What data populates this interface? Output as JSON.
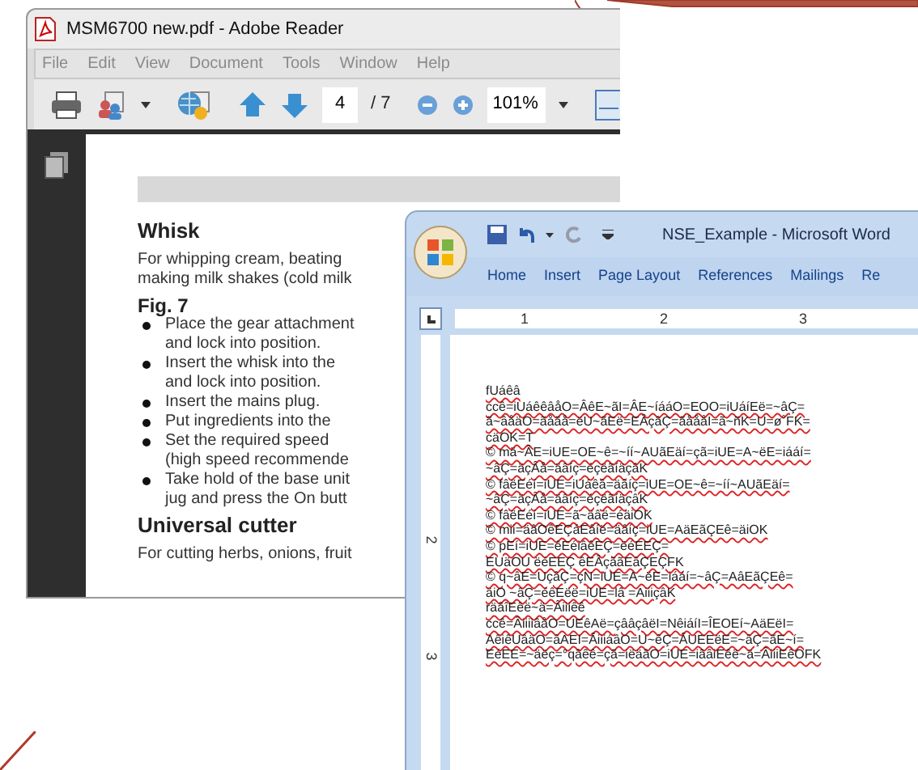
{
  "reader": {
    "title": "MSM6700 new.pdf - Adobe Reader",
    "menu": [
      "File",
      "Edit",
      "View",
      "Document",
      "Tools",
      "Window",
      "Help"
    ],
    "page_number": "4",
    "page_total": "/ 7",
    "zoom": "101%",
    "content": [
      {
        "kind": "heading",
        "text": "Whisk"
      },
      {
        "kind": "para",
        "text": "For whipping cream, beating"
      },
      {
        "kind": "para",
        "text": "making milk shakes (cold milk"
      },
      {
        "kind": "subheading",
        "text": "Fig. 7"
      },
      {
        "kind": "bullet",
        "lines": [
          "Place the gear attachment",
          "and lock into position."
        ]
      },
      {
        "kind": "bullet",
        "lines": [
          "Insert the whisk into the",
          "and lock into position."
        ]
      },
      {
        "kind": "bullet",
        "lines": [
          "Insert the mains plug."
        ]
      },
      {
        "kind": "bullet",
        "lines": [
          "Put ingredients into the"
        ]
      },
      {
        "kind": "bullet",
        "lines": [
          "Set the required speed",
          "(high speed recommende"
        ]
      },
      {
        "kind": "bullet",
        "lines": [
          "Take hold of the base unit",
          "jug and press the On butt"
        ]
      },
      {
        "kind": "heading",
        "text": "Universal cutter"
      },
      {
        "kind": "para",
        "text": "For cutting herbs, onions, fruit"
      }
    ]
  },
  "word": {
    "title": "NSE_Example - Microsoft Word",
    "tabs": [
      "Home",
      "Insert",
      "Page Layout",
      "References",
      "Mailings",
      "Re"
    ],
    "ruler": [
      "1",
      "2",
      "3"
    ],
    "vruler": [
      "2",
      "3"
    ],
    "lines": [
      "fUáêâ",
      "ccê=iUáêêâåO=ÂêE~ãI=ÂE~íááO=EOO=iUáíEë=~âÇ=",
      "ã~âåäO=ãåãå=ëU~ãEë=EÂçâÇ=ãåååI=ã~ñK=U=ø˚FK=",
      "cäOK=T",
      "© mä~ÂE=iUE=OE~ê=~íí~AUãEäí=çã=iUE=A~ëE=iááí=",
      "~âÇ=äçÂå=äâíç=éçëãíäçâK",
      "© fâëEéí=iUE=iUáêâ=äâíç=iUE=OE~ê=~íí~AUãEäí=",
      "~âÇ=äçÂå=äâíç=éçëãíäçâK",
      "© fâëEéí=iUE=ã~äâë=éäiOK",
      "© mii=äâOêEÇáEâíë=äâíç=iUE=AäEãÇEê=äiOK",
      "© pEí=iUE=êEéiâêEÇ=ëéEEÇ=",
      "EUäOU ëéEEÇ êEÂçããEâÇEÇFK",
      "© q~âE=UçâÇ=çN=iUE=A~ëE=iááí=~âÇ=AâEãÇEê=",
      "äiO ~âÇ=éêEëë=iUE=lâ =AiiiçâK",
      "räâîEêë~ä=Âiiiêê",
      "ccê=ÂiiiiâåO=UEêAë=çââçâëI=NêiáíI=ÎEOEí~AäEëI=",
      "AêiêUâäO=âAEI=ÂiiiáâO=U~êÇ=ÂUEEëE=~âÇ=ãE~í=",
      "EéEE=~äëç=°qâêê=çã=iëäâO=iUE=iââiEêë~ä=ÂiiiEêOFK"
    ]
  }
}
